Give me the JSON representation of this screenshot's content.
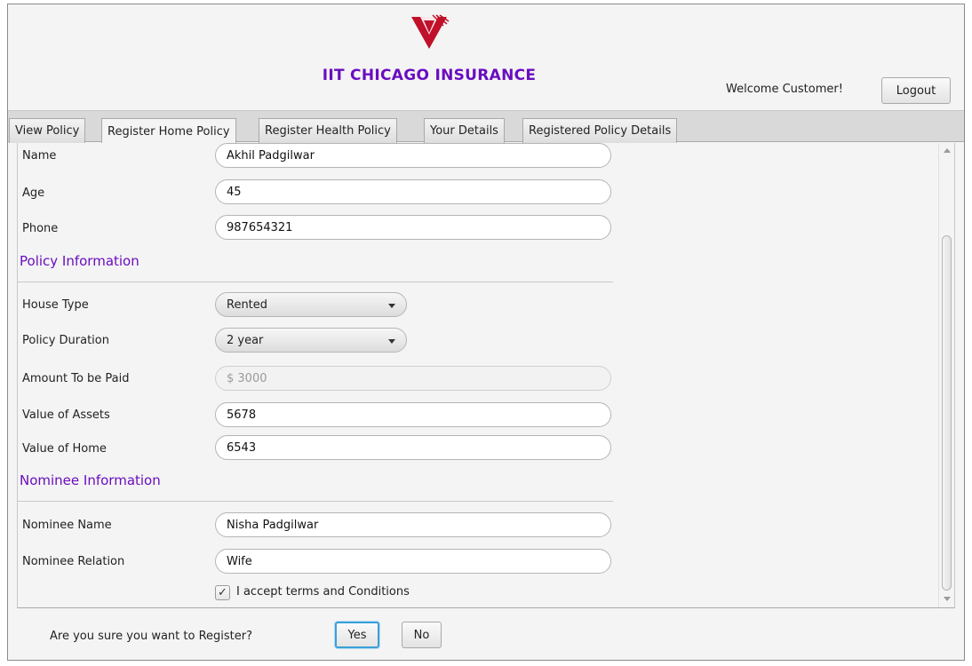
{
  "app": {
    "title": "IIT CHICAGO INSURANCE",
    "welcome": "Welcome Customer!",
    "logout_label": "Logout",
    "accent_color": "#6a0dbf",
    "logo_icon": "iit-logo-icon"
  },
  "tabs": [
    {
      "label": "View Policy",
      "active": false
    },
    {
      "label": "Register Home Policy",
      "active": true
    },
    {
      "label": "Register Health Policy",
      "active": false
    },
    {
      "label": "Your Details",
      "active": false
    },
    {
      "label": "Registered Policy Details",
      "active": false
    }
  ],
  "personal": {
    "name_label": "Name",
    "name_value": "Akhil Padgilwar",
    "age_label": "Age",
    "age_value": "45",
    "phone_label": "Phone",
    "phone_value": "987654321"
  },
  "policy": {
    "section_title": "Policy Information",
    "house_type_label": "House Type",
    "house_type_value": "Rented",
    "duration_label": "Policy Duration",
    "duration_value": "2 year",
    "amount_label": "Amount To be Paid",
    "amount_placeholder": "$ 3000",
    "assets_label": "Value of Assets",
    "assets_value": "5678",
    "home_label": "Value of Home",
    "home_value": "6543"
  },
  "nominee": {
    "section_title": "Nominee Information",
    "name_label": "Nominee Name",
    "name_value": "Nisha Padgilwar",
    "relation_label": "Nominee Relation",
    "relation_value": "Wife"
  },
  "terms": {
    "label": "I accept terms and Conditions",
    "checked": true
  },
  "confirm": {
    "question": "Are you sure you want to Register?",
    "yes_label": "Yes",
    "no_label": "No"
  }
}
